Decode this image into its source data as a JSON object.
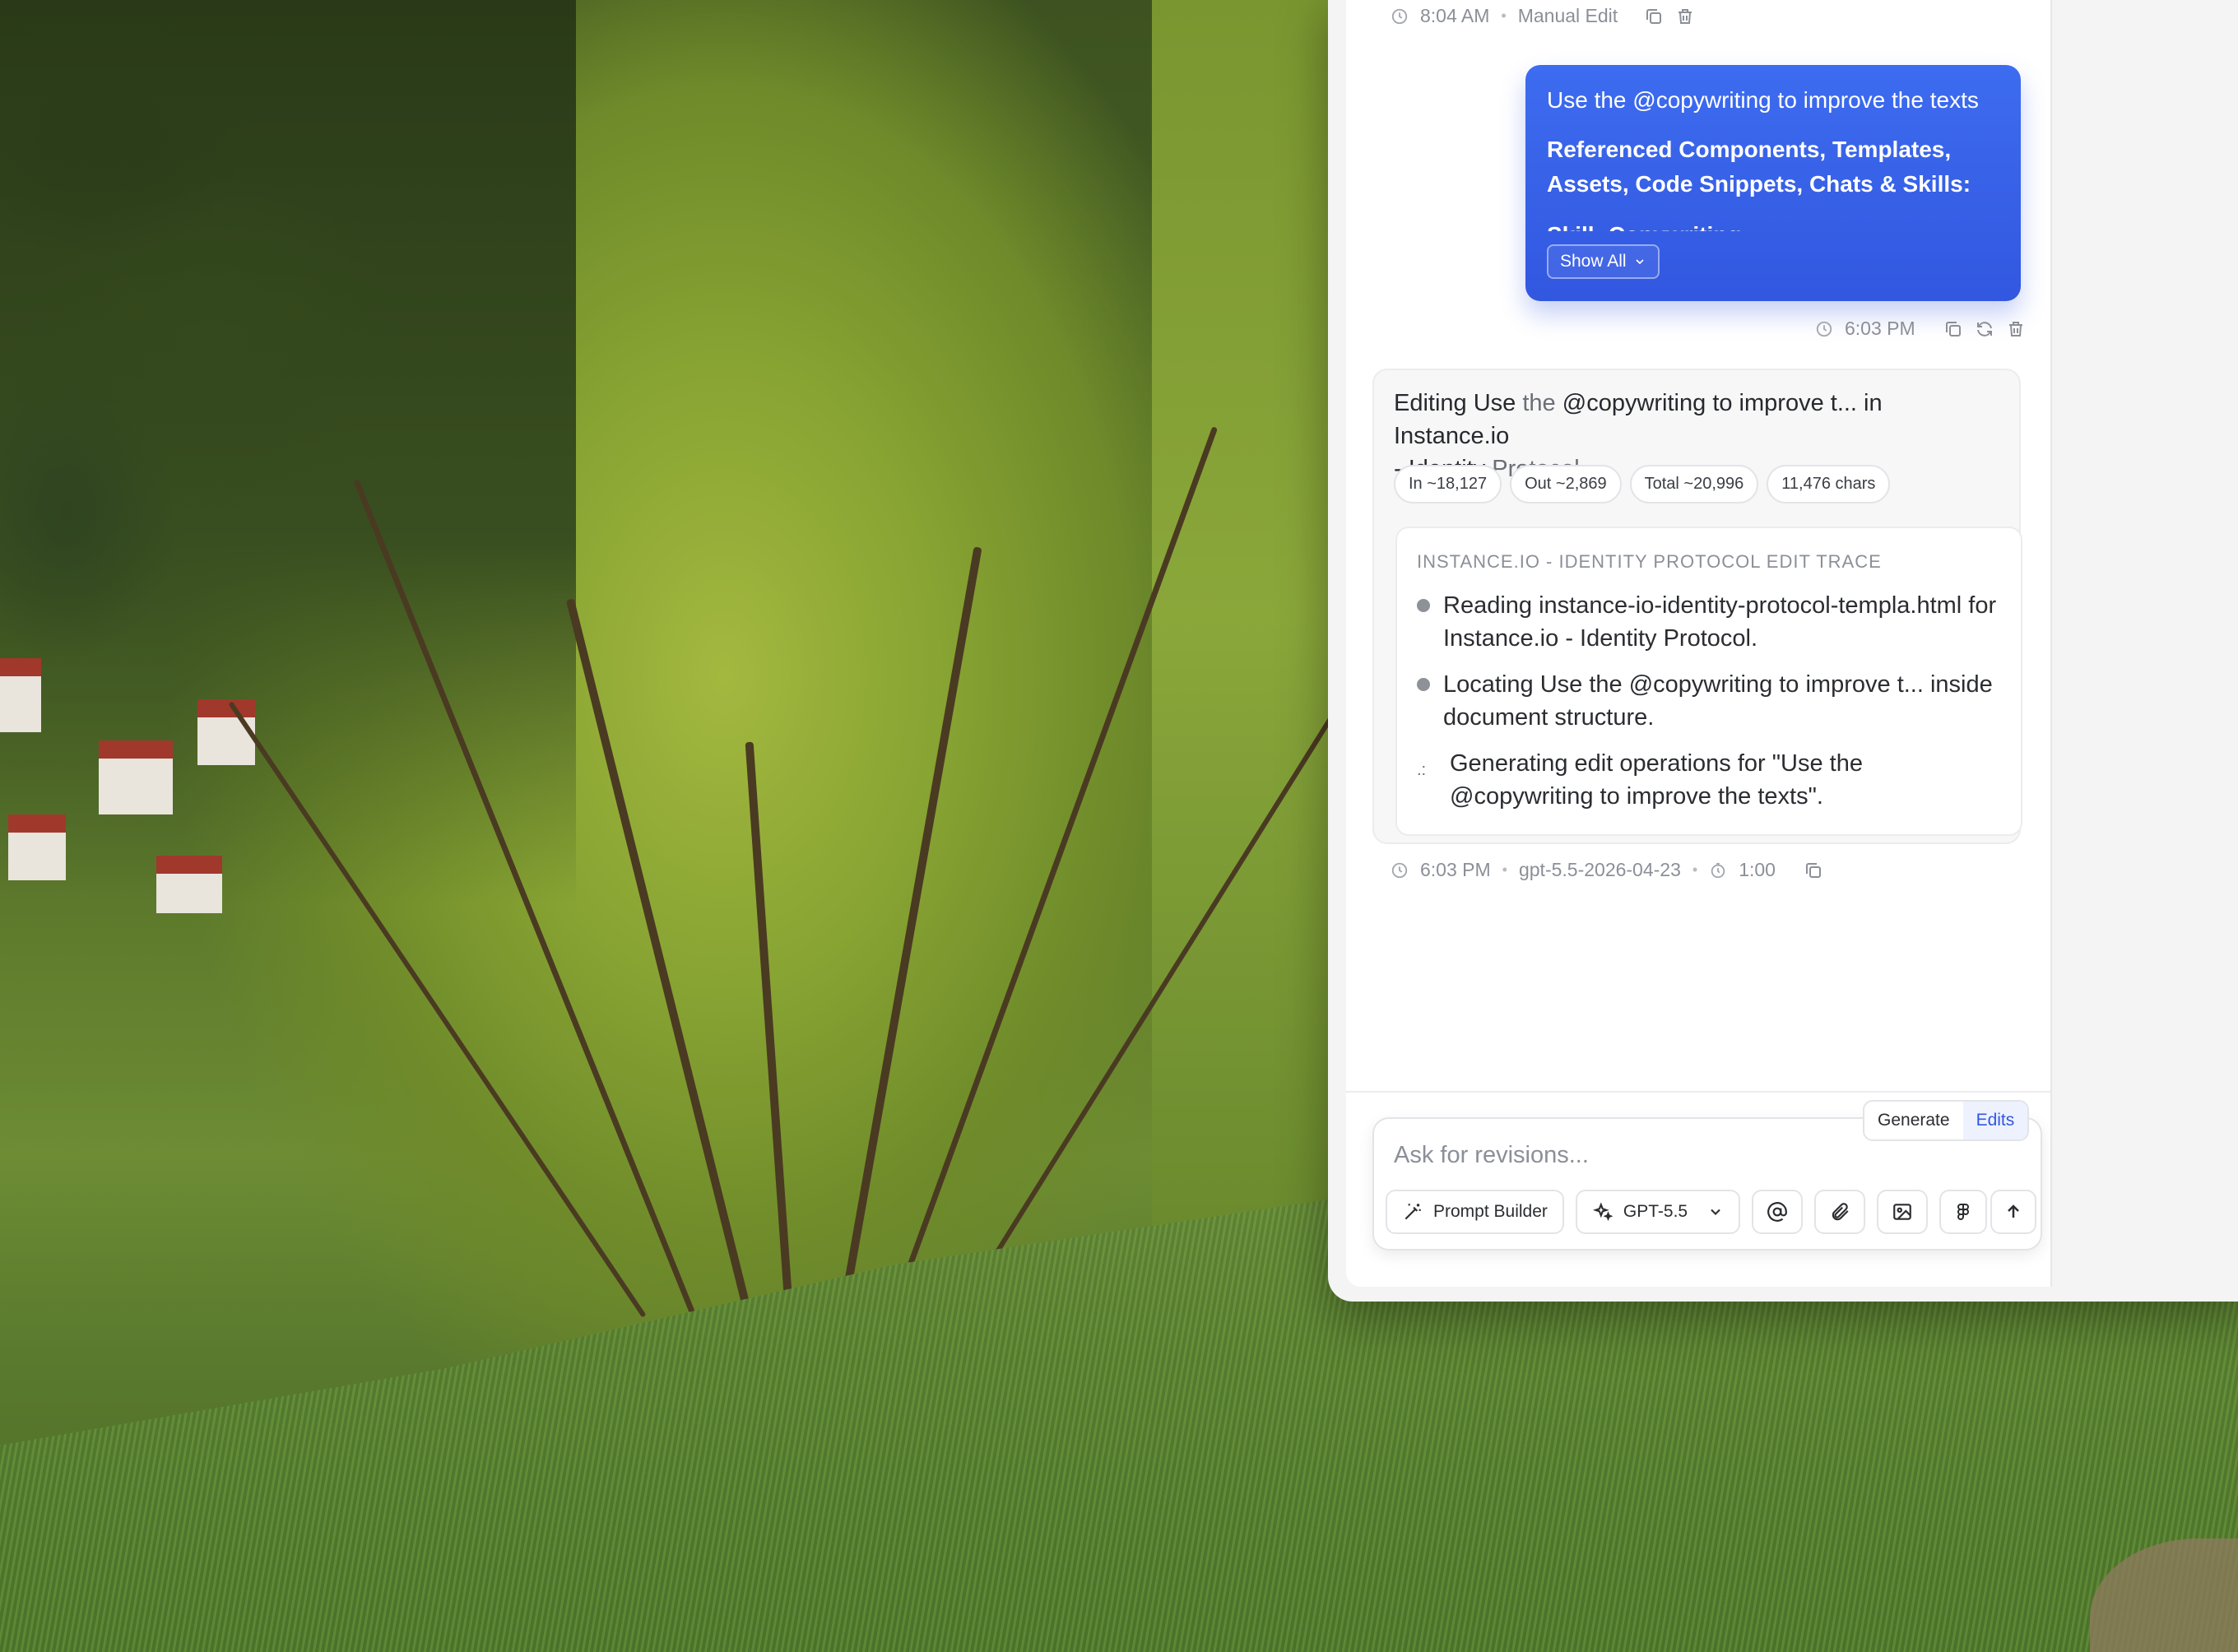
{
  "top_meta": {
    "time": "8:04 AM",
    "separator": "•",
    "label": "Manual Edit"
  },
  "user_message": {
    "line1": "Use the @copywriting to improve the texts",
    "line2": "Referenced Components, Templates, Assets, Code Snippets, Chats & Skills:",
    "line3": "Skill: Copywriting",
    "show_all_label": "Show All",
    "time": "6:03 PM"
  },
  "assistant": {
    "title_prefix": "Editing",
    "title_use": "Use",
    "title_the": "the",
    "title_rest": "@copywriting to improve t... in Instance.io",
    "title_line2_start": "- Identity",
    "title_line2_end": "Protocol...",
    "chips": [
      "In ~18,127",
      "Out ~2,869",
      "Total ~20,996",
      "11,476 chars"
    ],
    "trace_heading": "INSTANCE.IO - IDENTITY PROTOCOL EDIT TRACE",
    "trace_items": [
      "Reading instance-io-identity-protocol-templa.html for Instance.io - Identity Protocol.",
      "Locating Use the @copywriting to improve t... inside document structure.",
      "Generating edit operations for \"Use the @copywriting to improve the texts\"."
    ],
    "spinner_glyph": ".:",
    "footer": {
      "time": "6:03 PM",
      "separator": "•",
      "model": "gpt-5.5-2026-04-23",
      "duration": "1:00"
    }
  },
  "composer": {
    "placeholder": "Ask for revisions...",
    "value": "",
    "mode_generate": "Generate",
    "mode_edits": "Edits",
    "active_mode": "Edits",
    "prompt_builder_label": "Prompt Builder",
    "model_label": "GPT-5.5"
  },
  "colors": {
    "accent": "#3257e0",
    "user_bubble": "#3d6cf0",
    "muted_text": "#8b8f97"
  },
  "icons": [
    "clock-icon",
    "copy-icon",
    "trash-icon",
    "refresh-icon",
    "chevron-down-icon",
    "timer-icon",
    "magic-wand-icon",
    "sparkle-icon",
    "at-sign-icon",
    "paperclip-icon",
    "image-icon",
    "figma-icon",
    "arrow-up-icon"
  ]
}
